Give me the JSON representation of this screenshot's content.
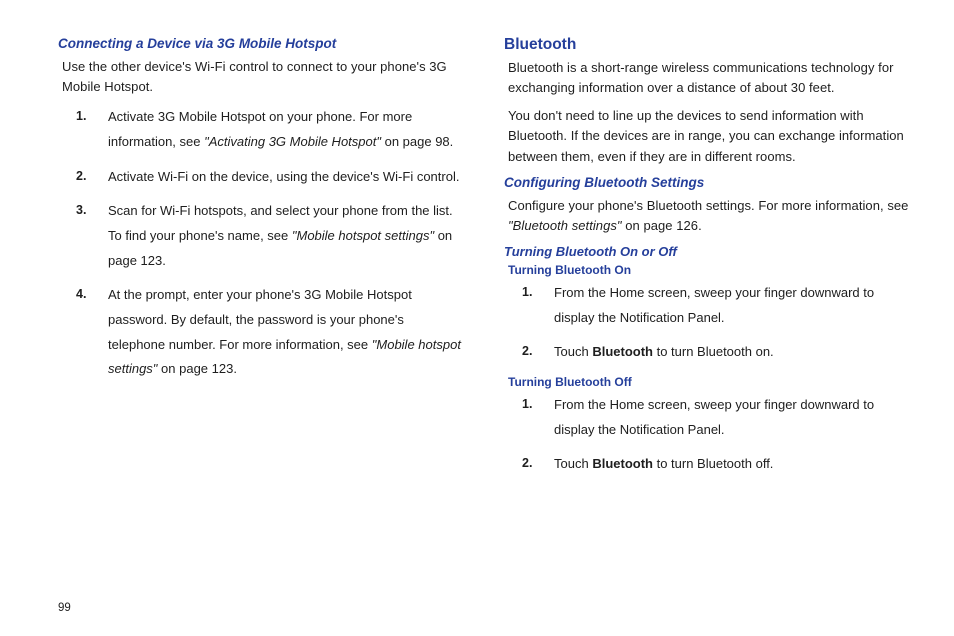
{
  "left": {
    "heading": "Connecting a Device via 3G Mobile Hotspot",
    "intro": "Use the other device's Wi-Fi control to connect to your phone's 3G Mobile Hotspot.",
    "steps": [
      {
        "pre": "Activate 3G Mobile Hotspot on your phone. For more information, see ",
        "link": "\"Activating 3G Mobile Hotspot\"",
        "post": " on page 98."
      },
      {
        "pre": "Activate Wi-Fi on the device, using the device's Wi-Fi control.",
        "link": "",
        "post": ""
      },
      {
        "pre": "Scan for Wi-Fi hotspots, and select your phone from the list. To find your phone's name, see ",
        "link": "\"Mobile hotspot settings\"",
        "post": " on page 123."
      },
      {
        "pre": "At the prompt, enter your phone's 3G Mobile Hotspot password. By default, the password is your phone's telephone number. For more information, see ",
        "link": "\"Mobile hotspot settings\"",
        "post": " on page 123."
      }
    ]
  },
  "right": {
    "title": "Bluetooth",
    "para1": "Bluetooth is a short-range wireless communications technology for exchanging information over a distance of about 30 feet.",
    "para2": "You don't need to line up the devices to send information with Bluetooth. If the devices are in range, you can exchange information between them, even if they are in different rooms.",
    "cfg_heading": "Configuring Bluetooth Settings",
    "cfg_body_pre": "Configure your phone's Bluetooth settings. For more information, see ",
    "cfg_link": "\"Bluetooth settings\"",
    "cfg_body_post": " on page 126.",
    "toggle_heading": "Turning Bluetooth On or Off",
    "on_heading": "Turning Bluetooth On",
    "on_steps": [
      {
        "pre": "From the Home screen, sweep your finger downward to display the Notification Panel.",
        "bold": "",
        "post": ""
      },
      {
        "pre": "Touch ",
        "bold": "Bluetooth",
        "post": " to turn Bluetooth on."
      }
    ],
    "off_heading": "Turning Bluetooth Off",
    "off_steps": [
      {
        "pre": "From the Home screen, sweep your finger downward to display the Notification Panel.",
        "bold": "",
        "post": ""
      },
      {
        "pre": "Touch ",
        "bold": "Bluetooth",
        "post": " to turn Bluetooth off."
      }
    ]
  },
  "page_number": "99"
}
